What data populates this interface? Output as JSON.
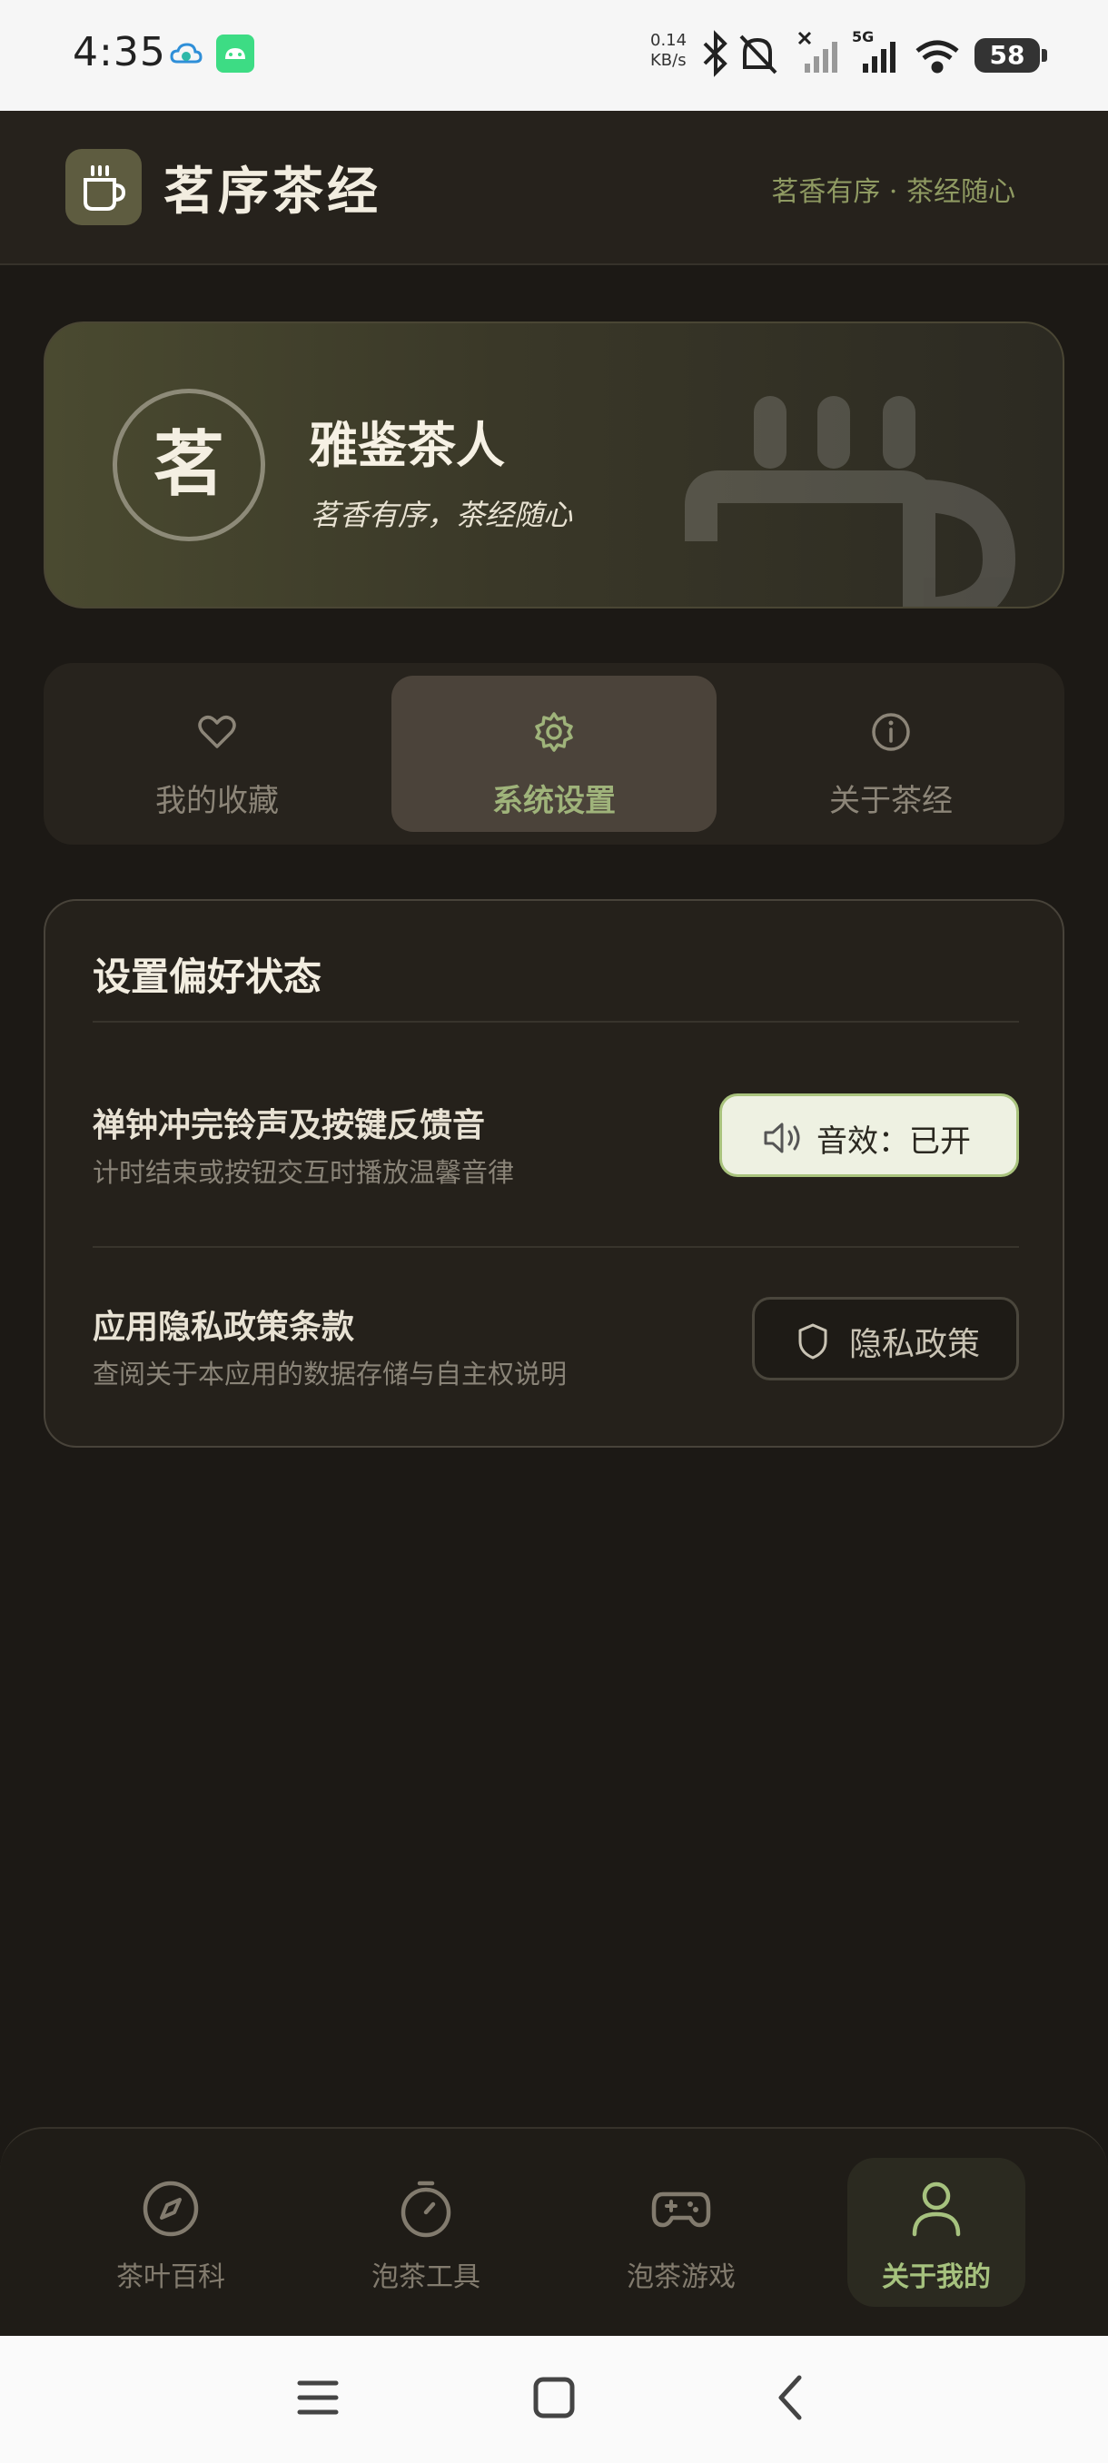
{
  "status_bar": {
    "time": "4:35",
    "net_speed_value": "0.14",
    "net_speed_unit": "KB/s",
    "battery": "58",
    "icons": [
      "cloud-icon",
      "android-icon",
      "bluetooth-icon",
      "mute-icon",
      "signal-off-icon",
      "5g-signal-icon",
      "wifi-icon",
      "battery-icon"
    ]
  },
  "header": {
    "title": "茗序茶经",
    "slogan": "茗香有序 · 茶经随心"
  },
  "profile": {
    "avatar_char": "茗",
    "name": "雅鉴茶人",
    "motto": "茗香有序，茶经随心"
  },
  "tabs": [
    {
      "label": "我的收藏",
      "icon": "heart-icon",
      "active": false
    },
    {
      "label": "系统设置",
      "icon": "gear-icon",
      "active": true
    },
    {
      "label": "关于茶经",
      "icon": "info-icon",
      "active": false
    }
  ],
  "settings": {
    "title": "设置偏好状态",
    "rows": [
      {
        "title": "禅钟冲完铃声及按键反馈音",
        "desc": "计时结束或按钮交互时播放温馨音律",
        "button": "音效：已开"
      },
      {
        "title": "应用隐私政策条款",
        "desc": "查阅关于本应用的数据存储与自主权说明",
        "button": "隐私政策"
      }
    ]
  },
  "bottom_nav": [
    {
      "label": "茶叶百科",
      "icon": "compass-icon",
      "active": false
    },
    {
      "label": "泡茶工具",
      "icon": "timer-icon",
      "active": false
    },
    {
      "label": "泡茶游戏",
      "icon": "gamepad-icon",
      "active": false
    },
    {
      "label": "关于我的",
      "icon": "user-icon",
      "active": true
    }
  ],
  "colors": {
    "background": "#1c1915",
    "accent_green": "#a6c27e",
    "header_bg": "#26221c",
    "sound_button_bg": "#eef1e2"
  }
}
